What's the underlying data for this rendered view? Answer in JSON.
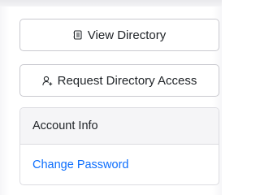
{
  "actions": {
    "view_directory": {
      "label": "View Directory",
      "icon": "address-book-icon"
    },
    "request_access": {
      "label": "Request Directory Access",
      "icon": "person-add-icon"
    }
  },
  "account_card": {
    "title": "Account Info",
    "links": [
      {
        "label": "Change Password"
      }
    ]
  },
  "colors": {
    "link": "#0d6efd",
    "text": "#212529",
    "border": "#c9c9cf",
    "card_header_bg": "#f5f5f7"
  }
}
